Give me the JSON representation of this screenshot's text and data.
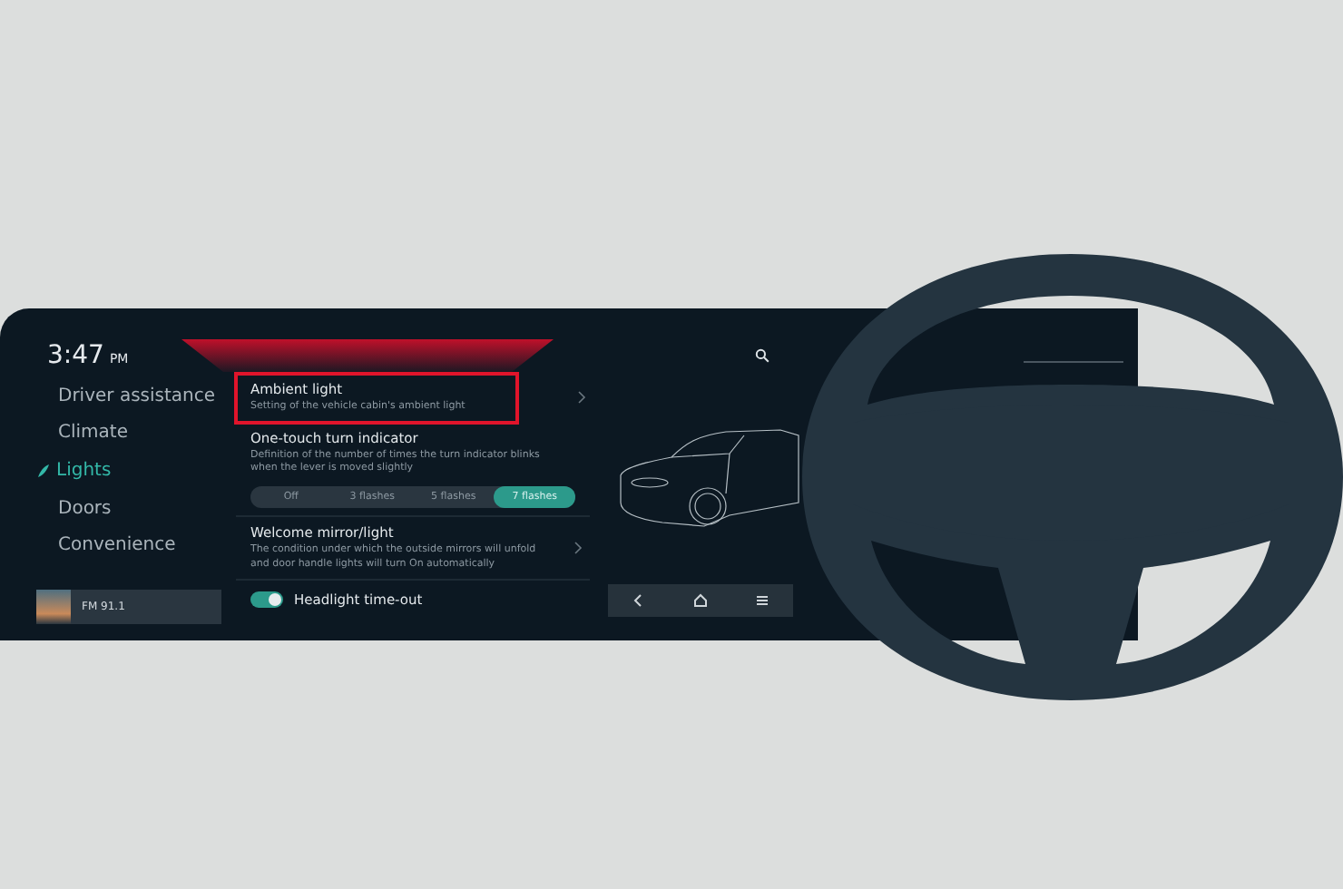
{
  "clock": {
    "time": "3:47",
    "period": "PM"
  },
  "menu": [
    {
      "label": "Driver assistance",
      "selected": false
    },
    {
      "label": "Climate",
      "selected": false
    },
    {
      "label": "Lights",
      "selected": true
    },
    {
      "label": "Doors",
      "selected": false
    },
    {
      "label": "Convenience",
      "selected": false
    }
  ],
  "media": {
    "station": "FM 91.1"
  },
  "settings": [
    {
      "kind": "link",
      "title": "Ambient light",
      "description": "Setting of the vehicle cabin's ambient light",
      "highlighted": true
    },
    {
      "kind": "segmented",
      "title": "One-touch turn indicator",
      "description": "Definition of the number of times the turn indicator blinks when the lever is moved slightly",
      "options": [
        {
          "label": "Off",
          "selected": false
        },
        {
          "label": "3 flashes",
          "selected": false
        },
        {
          "label": "5 flashes",
          "selected": false
        },
        {
          "label": "7 flashes",
          "selected": true
        }
      ]
    },
    {
      "kind": "link",
      "title": "Welcome mirror/light",
      "description": "The condition under which the outside mirrors will unfold and door handle lights will turn On automatically",
      "highlighted": false
    },
    {
      "kind": "toggle",
      "title": "Headlight time-out",
      "on": true
    }
  ]
}
